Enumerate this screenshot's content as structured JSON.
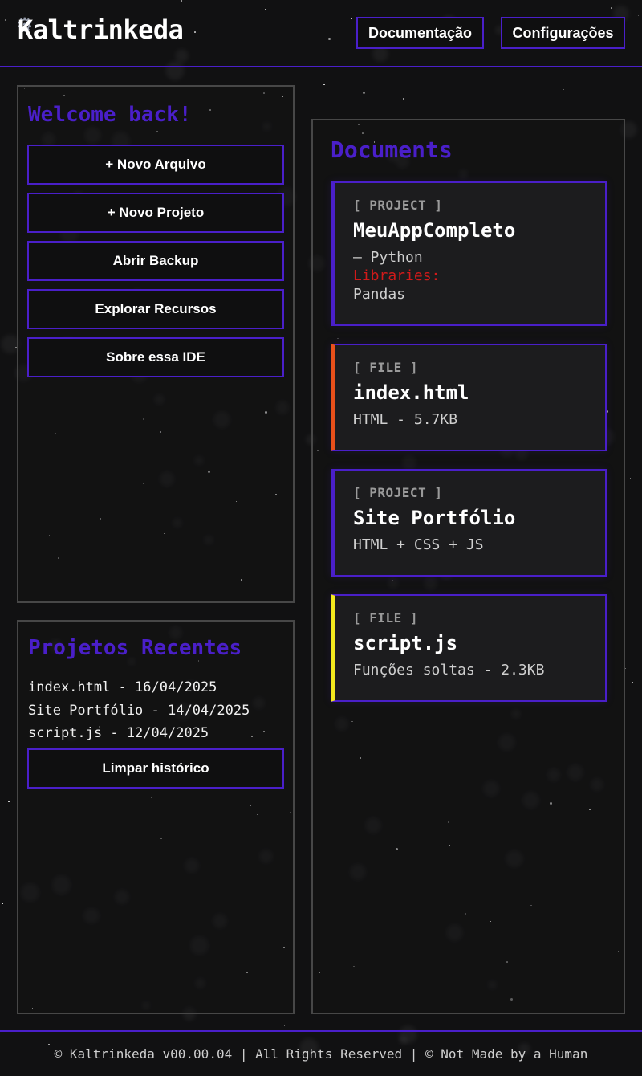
{
  "header": {
    "logo_icon": "⚙",
    "logo_text": "Kaltrinkeda",
    "nav": [
      {
        "label": "Documentação"
      },
      {
        "label": "Configurações"
      }
    ]
  },
  "welcome_panel": {
    "title": "Welcome back!",
    "actions": [
      {
        "label": "+ Novo Arquivo"
      },
      {
        "label": "+ Novo Projeto"
      },
      {
        "label": "Abrir Backup"
      },
      {
        "label": "Explorar Recursos"
      },
      {
        "label": "Sobre essa IDE"
      }
    ]
  },
  "recent_panel": {
    "title": "Projetos Recentes",
    "items": [
      {
        "text": "index.html - 16/04/2025"
      },
      {
        "text": "Site Portfólio - 14/04/2025"
      },
      {
        "text": "script.js - 12/04/2025"
      }
    ],
    "clear_label": "Limpar histórico"
  },
  "documents": {
    "title": "Documents",
    "cards": [
      {
        "tag": "[ PROJECT ]",
        "name": "MeuAppCompleto",
        "lang": "— Python",
        "libraries_label": "Libraries:",
        "libraries": "Pandas",
        "accent_color": "#4a1fc9"
      },
      {
        "tag": "[ FILE ]",
        "name": "index.html",
        "desc": "HTML - 5.7KB",
        "accent_color": "#e8501a"
      },
      {
        "tag": "[ PROJECT ]",
        "name": "Site Portfólio",
        "desc": "HTML + CSS + JS",
        "accent_color": "#4a1fc9"
      },
      {
        "tag": "[ FILE ]",
        "name": "script.js",
        "desc": "Funções soltas - 2.3KB",
        "accent_color": "#f2e81d"
      }
    ]
  },
  "footer": {
    "text": "© Kaltrinkeda v00.00.04 | All Rights Reserved | © Not Made by a Human"
  },
  "theme": {
    "accent": "#4a1fc9",
    "background": "#111112",
    "panel_border": "#474747"
  }
}
